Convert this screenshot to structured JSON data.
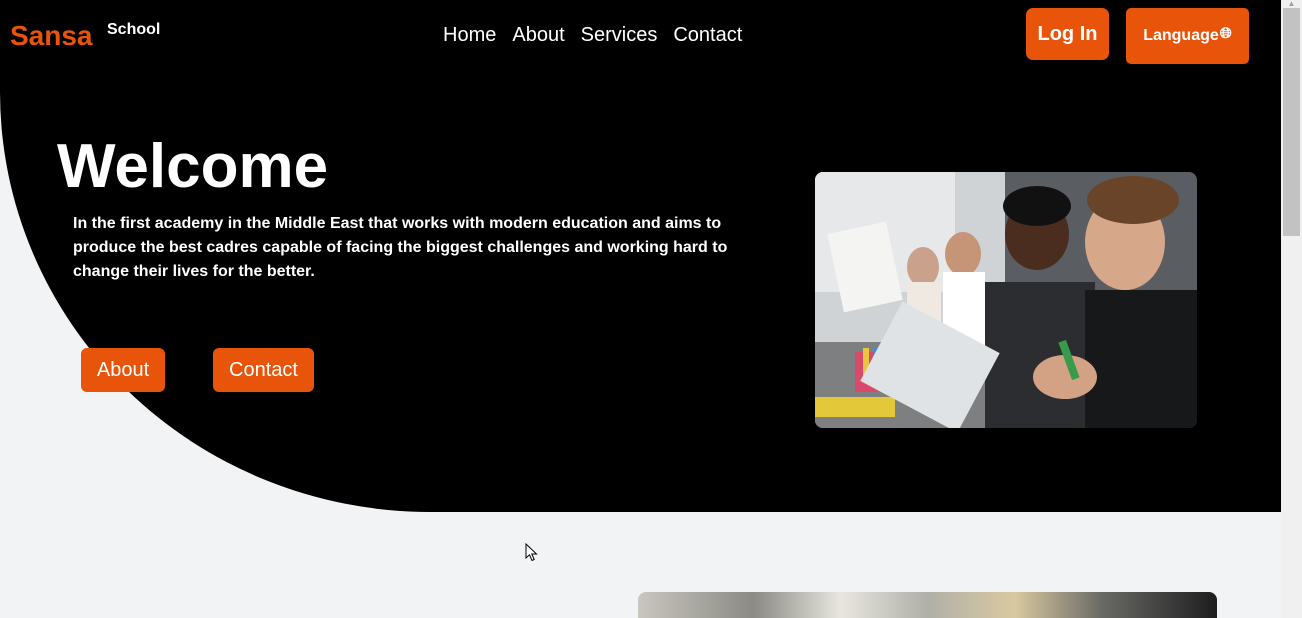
{
  "brand": {
    "name": "Sansa",
    "sub": "School"
  },
  "nav": {
    "items": [
      "Home",
      "About",
      "Services",
      "Contact"
    ]
  },
  "header": {
    "login_label": "Log In",
    "language_label": "Language",
    "language_icon": "globe-icon"
  },
  "hero": {
    "title": "Welcome",
    "text": "In the first academy in the Middle East that works with modern education and aims to produce the best cadres capable of facing the biggest challenges and working hard to change their lives for the better.",
    "about_label": "About",
    "contact_label": "Contact"
  },
  "colors": {
    "accent": "#e8540a",
    "hero_bg": "#000000",
    "page_bg": "#f2f3f5"
  }
}
